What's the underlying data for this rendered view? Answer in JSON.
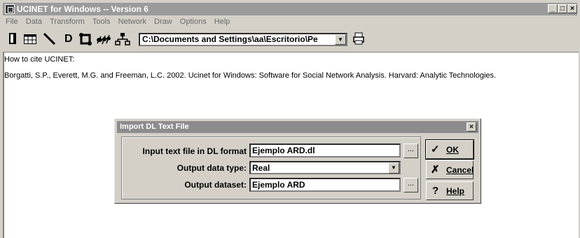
{
  "window": {
    "title": "UCINET for Windows -- Version 6",
    "controls": [
      "_",
      "□",
      "×"
    ]
  },
  "menu": [
    "File",
    "Data",
    "Transform",
    "Tools",
    "Network",
    "Draw",
    "Options",
    "Help"
  ],
  "toolbar": {
    "icons": [
      "open-file-icon",
      "spreadsheet-icon",
      "line-icon",
      "text-d-icon",
      "netdraw-icon",
      "ant-icon",
      "network-icon",
      "printer-icon"
    ],
    "d_label": "D",
    "path_value": "C:\\Documents and Settings\\aa\\Escritorio\\Pe"
  },
  "content": {
    "heading": "How to cite UCINET:",
    "citation": "Borgatti, S.P., Everett, M.G. and Freeman, L.C. 2002. Ucinet for Windows: Software for Social Network Analysis. Harvard: Analytic Technologies."
  },
  "dialog": {
    "title": "Import DL Text File",
    "close": "×",
    "input_label": "Input text file in DL format",
    "input_value": "Ejemplo ARD.dl",
    "type_label": "Output data type:",
    "type_value": "Real",
    "output_label": "Output dataset:",
    "output_value": "Ejemplo ARD",
    "browse": "...",
    "ok_label": "OK",
    "cancel_label": "Cancel",
    "help_label": "Help"
  }
}
